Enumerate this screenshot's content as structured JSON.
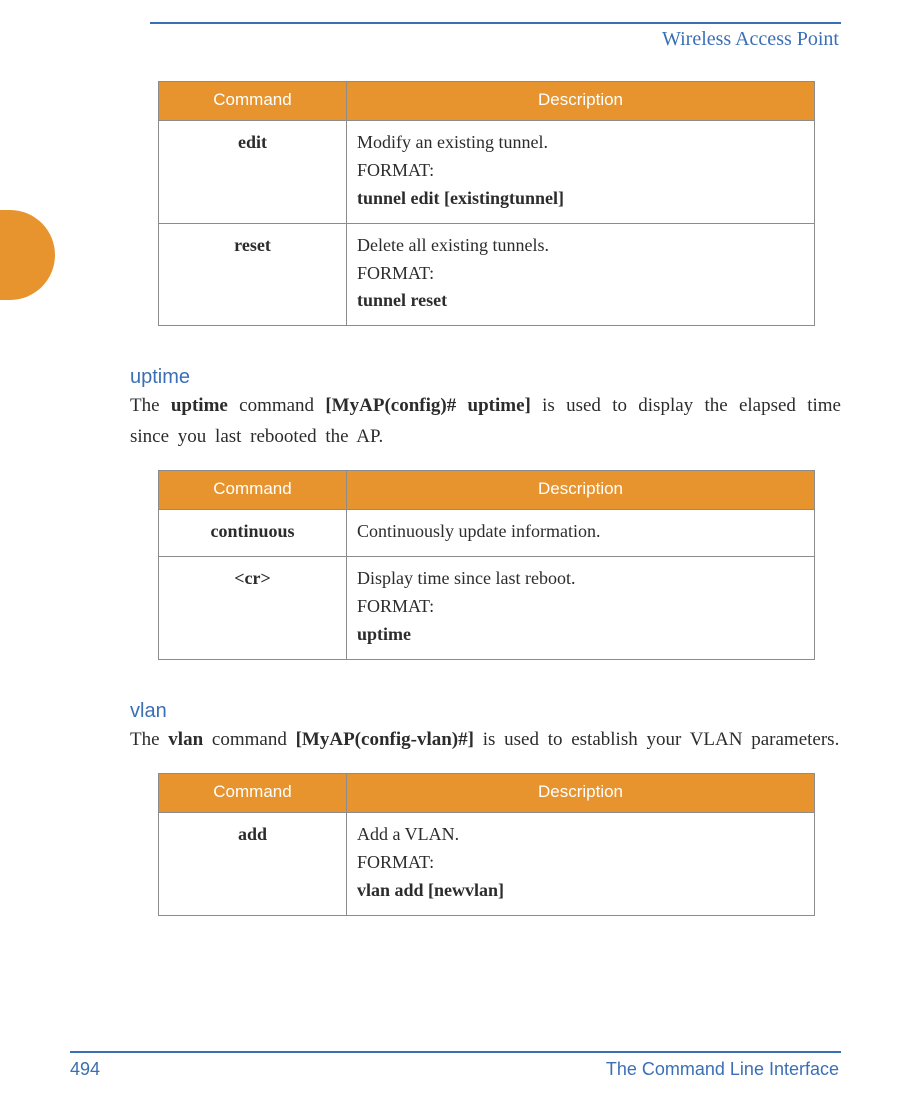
{
  "header": {
    "title": "Wireless Access Point"
  },
  "table1": {
    "headers": {
      "command": "Command",
      "description": "Description"
    },
    "rows": [
      {
        "cmd": "edit",
        "lines": [
          "Modify an existing tunnel.",
          "FORMAT:",
          "tunnel edit [existingtunnel]"
        ],
        "bold": [
          false,
          false,
          true
        ]
      },
      {
        "cmd": "reset",
        "lines": [
          "Delete all existing tunnels.",
          "FORMAT:",
          "tunnel reset"
        ],
        "bold": [
          false,
          false,
          true
        ]
      }
    ]
  },
  "section_uptime": {
    "heading": "uptime",
    "para_parts": [
      {
        "t": "The ",
        "b": false
      },
      {
        "t": "uptime",
        "b": true
      },
      {
        "t": " command ",
        "b": false
      },
      {
        "t": "[MyAP(config)# uptime]",
        "b": true
      },
      {
        "t": " is used to display the elapsed time since you last rebooted the AP.",
        "b": false
      }
    ]
  },
  "table2": {
    "headers": {
      "command": "Command",
      "description": "Description"
    },
    "rows": [
      {
        "cmd": "continuous",
        "lines": [
          "Continuously update information."
        ],
        "bold": [
          false
        ]
      },
      {
        "cmd": "<cr>",
        "lines": [
          "Display time since last reboot.",
          "FORMAT:",
          "uptime"
        ],
        "bold": [
          false,
          false,
          true
        ]
      }
    ]
  },
  "section_vlan": {
    "heading": "vlan",
    "para_parts": [
      {
        "t": "The ",
        "b": false
      },
      {
        "t": "vlan",
        "b": true
      },
      {
        "t": " command ",
        "b": false
      },
      {
        "t": "[MyAP(config-vlan)#]",
        "b": true
      },
      {
        "t": " is used to establish your VLAN parameters.",
        "b": false
      }
    ]
  },
  "table3": {
    "headers": {
      "command": "Command",
      "description": "Description"
    },
    "rows": [
      {
        "cmd": "add",
        "lines": [
          "Add a VLAN.",
          "FORMAT:",
          "vlan add [newvlan]"
        ],
        "bold": [
          false,
          false,
          true
        ]
      }
    ]
  },
  "footer": {
    "page": "494",
    "section": "The Command Line Interface"
  }
}
